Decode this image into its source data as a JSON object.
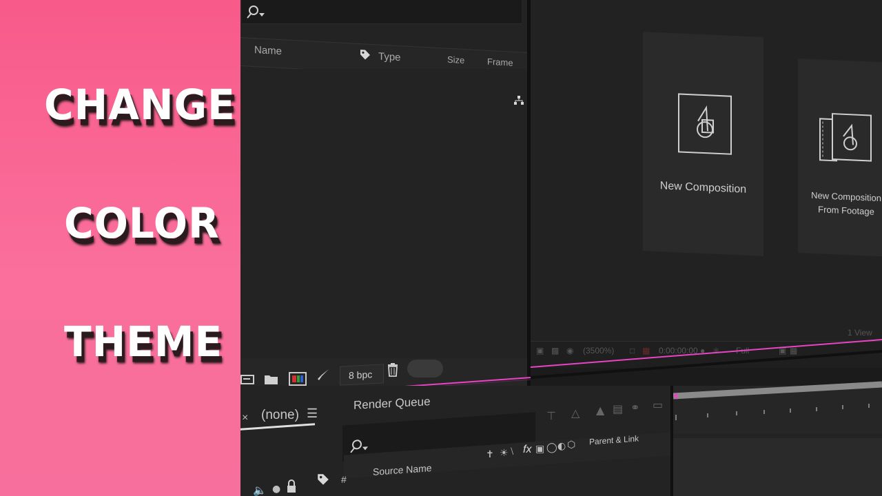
{
  "banner": {
    "words": [
      "CHANGE",
      "COLOR",
      "THEME"
    ],
    "background": "#f85a8a"
  },
  "project_panel": {
    "columns": {
      "name": "Name",
      "type": "Type",
      "size": "Size",
      "frame_rate": "Frame R..."
    },
    "bottom": {
      "bpc": "8 bpc"
    }
  },
  "viewer": {
    "new_composition": "New Composition",
    "new_composition_from_footage_line1": "New Composition",
    "new_composition_from_footage_line2": "From Footage",
    "zoom": "(3500%)",
    "timecode": "0:00:00:00",
    "resolution": "Full",
    "views": "1 View"
  },
  "timeline": {
    "comp_tab": "(none)",
    "render_queue": "Render Queue",
    "columns": {
      "hash": "#",
      "source_name": "Source Name",
      "parent_link": "Parent & Link"
    }
  },
  "colors": {
    "accent_pink": "#e845c6",
    "banner_pink": "#f85a8a",
    "panel_bg": "#232323"
  }
}
